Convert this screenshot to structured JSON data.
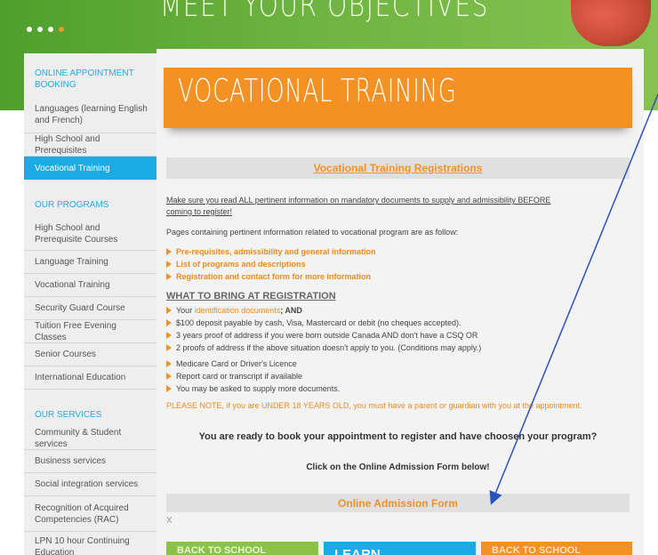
{
  "hero": {
    "title": "MEET YOUR OBJECTIVES",
    "dots": 4,
    "active_dot": 4
  },
  "sidebar": {
    "items": [
      {
        "label": "ONLINE APPOINTMENT BOOKING",
        "kind": "heading"
      },
      {
        "label": "Languages (learning English and French)",
        "kind": "link"
      },
      {
        "label": "High School and Prerequisites",
        "kind": "link"
      },
      {
        "label": "Vocational Training",
        "kind": "active"
      },
      {
        "label": "OUR PROGRAMS",
        "kind": "heading"
      },
      {
        "label": "High School and Prerequisite Courses",
        "kind": "link"
      },
      {
        "label": "Language Training",
        "kind": "link"
      },
      {
        "label": "Vocational Training",
        "kind": "link"
      },
      {
        "label": "Security Guard Course",
        "kind": "link"
      },
      {
        "label": "Tuition Free Evening Classes",
        "kind": "link"
      },
      {
        "label": "Senior Courses",
        "kind": "link"
      },
      {
        "label": "International Education",
        "kind": "link"
      },
      {
        "label": "OUR SERVICES",
        "kind": "heading"
      },
      {
        "label": "Community & Student services",
        "kind": "link"
      },
      {
        "label": "Business services",
        "kind": "link"
      },
      {
        "label": "Social integration services",
        "kind": "link"
      },
      {
        "label": "Recognition of Acquired Competencies (RAC)",
        "kind": "link"
      },
      {
        "label": "LPN 10 hour Continuing Education",
        "kind": "link"
      }
    ]
  },
  "main": {
    "banner_title": "VOCATIONAL TRAINING",
    "registrations_link": "Vocational Training Registrations",
    "intro_line1": "Make sure you read ALL pertinent information on mandatory documents to supply and admissibility BEFORE",
    "intro_line2": "coming to register!",
    "pages_text": "Pages containing pertinent information related to vocational program are as follow:",
    "page_links": [
      "Pre-requisites, admissibility and general information",
      "List of programs and descriptions",
      "Registration and contact form for more information"
    ],
    "bring_heading": "WHAT TO BRING AT REGISTRATION",
    "bring_items": {
      "your": "Your",
      "id_docs": "identification documents",
      "and_text": "; AND",
      "deposit": "$100 deposit payable by cash, Visa, Mastercard or debit (no cheques accepted).",
      "proof3": "3 years proof of address if you were born outside Canada AND don't have a CSQ OR",
      "proof2": "2 proofs of address if the above situation doesn't apply to you. (Conditions may apply.)",
      "medicare": "Medicare Card or Driver's Licence",
      "report": "Report card or transcript if available",
      "more_docs": "You may be asked to supply more documents."
    },
    "notice": "PLEASE NOTE, if you are UNDER 18 YEARS OLD, you must have a parent or guardian with you at the appointment.",
    "ready_text": "You are ready to book your appointment to register and have choosen your program?",
    "click_text": "Click on the Online Admission Form below!",
    "admission_form_link": "Online Admission Form",
    "x_mark": "X",
    "tiles": [
      "BACK TO SCHOOL",
      "LEARN",
      "BACK TO SCHOOL"
    ]
  },
  "colors": {
    "accent_orange": "#f39125",
    "accent_blue": "#1aabe4",
    "hero_green": "#6db33f",
    "arrow_blue": "#2a52be"
  }
}
